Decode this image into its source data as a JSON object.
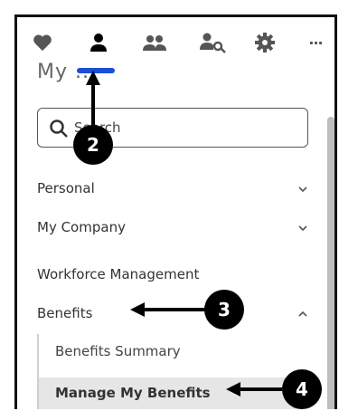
{
  "toolbar": {
    "icons": [
      "heart-icon",
      "person-icon",
      "people-icon",
      "person-key-icon",
      "gear-icon",
      "more-icon"
    ],
    "more_label": "···",
    "active_index": 1
  },
  "section_title": "My ...",
  "search": {
    "placeholder": "Search"
  },
  "nav": [
    {
      "label": "Personal",
      "chevron": "down"
    },
    {
      "label": "My Company",
      "chevron": "down"
    },
    {
      "label": "Workforce Management",
      "chevron": ""
    },
    {
      "label": "Benefits",
      "chevron": "up"
    }
  ],
  "benefits_sub": [
    {
      "label": "Benefits Summary",
      "active": false
    },
    {
      "label": "Manage My Benefits",
      "active": true
    }
  ],
  "callouts": [
    "2",
    "3",
    "4"
  ],
  "colors": {
    "accent": "#1a4fd6",
    "toolbar_icon": "#555555",
    "active_bg": "#e6e6e6"
  }
}
